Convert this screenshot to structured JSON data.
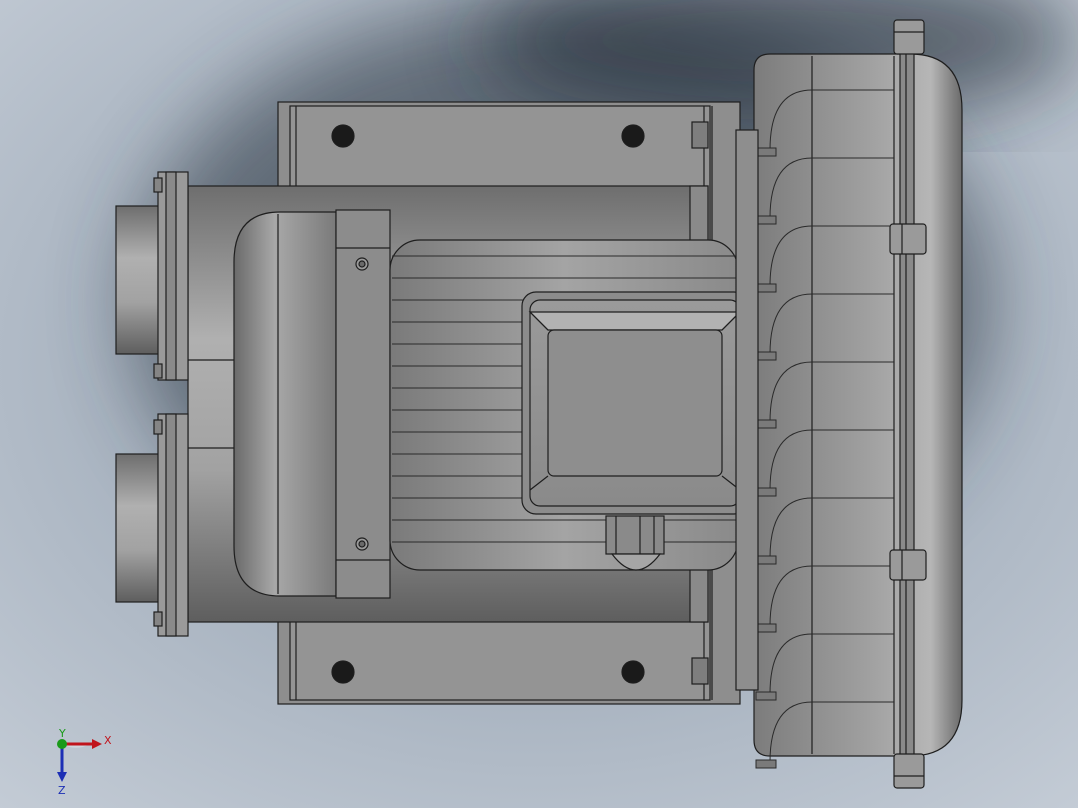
{
  "viewport": {
    "background_center": "#8a98a8",
    "background_edge": "#c4ccd6",
    "shadow_color": "#2a3440"
  },
  "model": {
    "body_color": "#8d8d8d",
    "body_light": "#b4b4b4",
    "body_dark": "#5c5c5c",
    "line_color": "#1e1e1e",
    "hole_color": "#1a1a1a"
  },
  "triad": {
    "x_label": "X",
    "y_label": "Y",
    "z_label": "Z",
    "x_color": "#c0141c",
    "y_color": "#1a9a1a",
    "z_color": "#1c2fb5"
  }
}
